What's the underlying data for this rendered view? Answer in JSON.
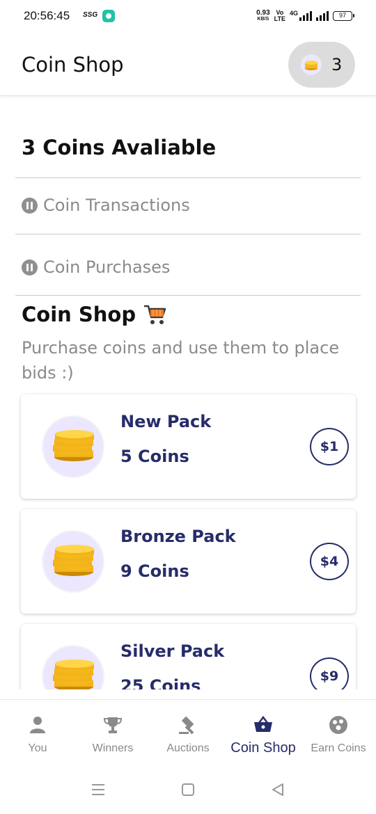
{
  "status_bar": {
    "time": "20:56:45",
    "carrier_tag": "SSG",
    "net_speed_value": "0.93",
    "net_speed_unit": "KB/S",
    "volte_top": "Vo",
    "volte_bottom": "LTE",
    "network_type": "4G",
    "battery": "97"
  },
  "header": {
    "title": "Coin Shop",
    "coin_count": "3"
  },
  "summary": {
    "coins_available": "3 Coins Avaliable"
  },
  "menu": [
    {
      "label": "Coin Transactions"
    },
    {
      "label": "Coin Purchases"
    }
  ],
  "shop": {
    "heading": "Coin Shop",
    "subtitle": "Purchase coins and use them to place bids :)"
  },
  "packs": [
    {
      "name": "New Pack",
      "coins": "5 Coins",
      "price": "$1"
    },
    {
      "name": "Bronze Pack",
      "coins": "9 Coins",
      "price": "$4"
    },
    {
      "name": "Silver Pack",
      "coins": "25 Coins",
      "price": "$9"
    }
  ],
  "bottom_nav": [
    {
      "label": "You",
      "icon": "person-icon",
      "active": false
    },
    {
      "label": "Winners",
      "icon": "trophy-icon",
      "active": false
    },
    {
      "label": "Auctions",
      "icon": "gavel-icon",
      "active": false
    },
    {
      "label": "Coin Shop",
      "icon": "basket-icon",
      "active": true
    },
    {
      "label": "Earn Coins",
      "icon": "coins-group-icon",
      "active": false
    }
  ],
  "colors": {
    "accent": "#262c6a",
    "muted_text": "#8a8a8a",
    "coin_bg": "#ece6ff",
    "coin_gold": "#f5b81c"
  }
}
